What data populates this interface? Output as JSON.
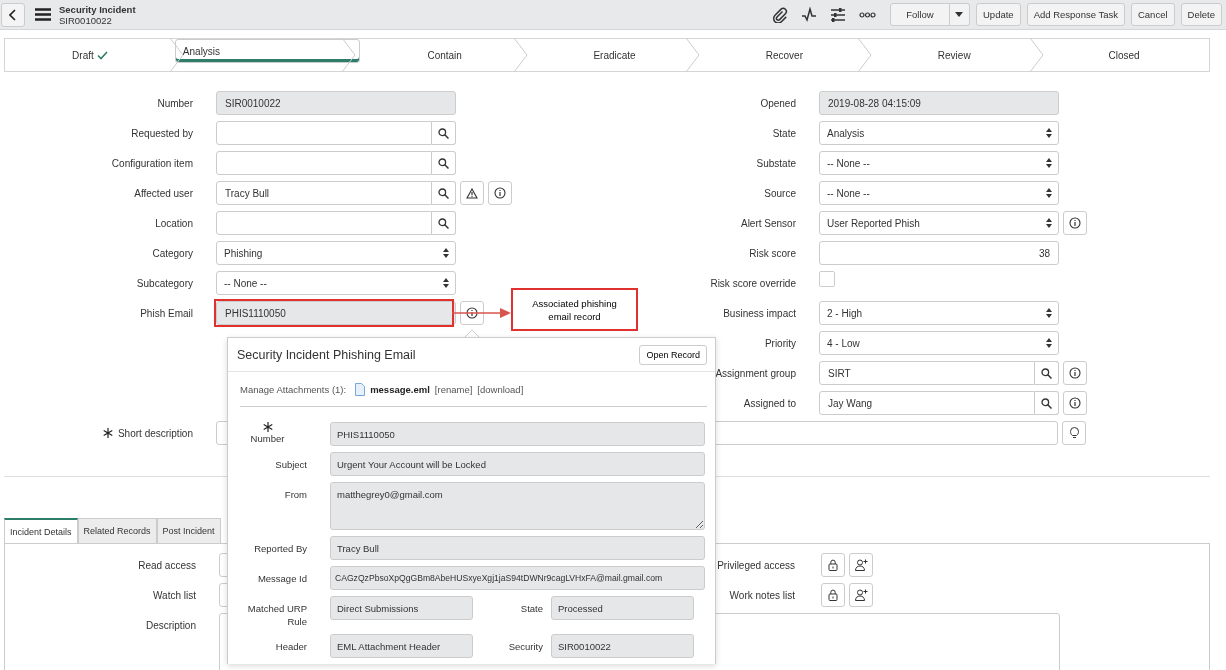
{
  "header": {
    "title": "Security Incident",
    "number": "SIR0010022",
    "buttons": [
      {
        "label": "Follow",
        "kind": "split"
      },
      {
        "label": "Update",
        "kind": "plain"
      },
      {
        "label": "Add Response Task",
        "kind": "plain"
      },
      {
        "label": "Cancel",
        "kind": "plain"
      },
      {
        "label": "Delete",
        "kind": "plain"
      }
    ]
  },
  "stages": [
    {
      "label": "Draft",
      "done": true,
      "selected": false
    },
    {
      "label": "Analysis",
      "done": false,
      "selected": true
    },
    {
      "label": "Contain",
      "done": false,
      "selected": false
    },
    {
      "label": "Eradicate",
      "done": false,
      "selected": false
    },
    {
      "label": "Recover",
      "done": false,
      "selected": false
    },
    {
      "label": "Review",
      "done": false,
      "selected": false
    },
    {
      "label": "Closed",
      "done": false,
      "selected": false
    }
  ],
  "left_fields": [
    {
      "label": "Number",
      "kind": "readonly",
      "value": "SIR0010022"
    },
    {
      "label": "Requested by",
      "kind": "lookup"
    },
    {
      "label": "Configuration item",
      "kind": "lookup"
    },
    {
      "label": "Affected user",
      "kind": "lookup",
      "value": "Tracy Bull",
      "actions": [
        {
          "kind": "alert"
        },
        {
          "kind": "info"
        }
      ]
    },
    {
      "label": "Location",
      "kind": "lookup"
    },
    {
      "label": "Category",
      "kind": "select",
      "value": "Phishing"
    },
    {
      "label": "Subcategory",
      "kind": "select",
      "value": "-- None --"
    },
    {
      "label": "Phish Email",
      "kind": "readonly",
      "value": "PHIS1110050",
      "actions": [
        {
          "kind": "info"
        }
      ],
      "highlighted": true
    }
  ],
  "right_fields": [
    {
      "label": "Opened",
      "kind": "readonly",
      "value": "2019-08-28 04:15:09"
    },
    {
      "label": "State",
      "kind": "select",
      "value": "Analysis"
    },
    {
      "label": "Substate",
      "kind": "select",
      "value": "-- None --"
    },
    {
      "label": "Source",
      "kind": "select",
      "value": "-- None --"
    },
    {
      "label": "Alert Sensor",
      "kind": "select",
      "value": "User Reported Phish",
      "actions": [
        {
          "kind": "info"
        }
      ]
    },
    {
      "label": "Risk score",
      "kind": "number",
      "value": "38"
    },
    {
      "label": "Risk score override",
      "kind": "checkbox",
      "checked": false
    },
    {
      "label": "Business impact",
      "kind": "select",
      "value": "2 - High"
    },
    {
      "label": "Priority",
      "kind": "select",
      "value": "4 - Low"
    },
    {
      "label": "Assignment group",
      "kind": "lookup",
      "value": "SIRT",
      "actions": [
        {
          "kind": "info"
        }
      ]
    },
    {
      "label": "Assigned to",
      "kind": "lookup",
      "value": "Jay Wang",
      "actions": [
        {
          "kind": "info"
        }
      ]
    }
  ],
  "short_description": {
    "label": "Short description",
    "required": true
  },
  "annotation": {
    "text": "Associated phishing email record"
  },
  "tabs": [
    {
      "label": "Incident Details",
      "selected": true
    },
    {
      "label": "Related Records",
      "selected": false
    },
    {
      "label": "Post Incident",
      "selected": false
    }
  ],
  "details": {
    "left": [
      {
        "label": "Read access",
        "kind": "text"
      },
      {
        "label": "Watch list",
        "kind": "text"
      }
    ],
    "right": [
      {
        "label": "Privileged access",
        "kind": "access"
      },
      {
        "label": "Work notes list",
        "kind": "access"
      }
    ],
    "description": {
      "label": "Description"
    }
  },
  "popup": {
    "title": "Security Incident Phishing Email",
    "open_button": "Open Record",
    "attachments_label": "Manage Attachments (1):",
    "file_name": "message.eml",
    "file_actions": [
      "[rename]",
      "[download]"
    ],
    "fields": [
      {
        "kind": "full",
        "label": "Number",
        "value": "PHIS1110050",
        "required": true
      },
      {
        "kind": "full",
        "label": "Subject",
        "value": "Urgent Your Account will be Locked"
      },
      {
        "kind": "textarea",
        "label": "From",
        "value": "matthegrey0@gmail.com"
      },
      {
        "kind": "full",
        "label": "Reported By",
        "value": "Tracy Bull"
      },
      {
        "kind": "full",
        "label": "Message Id",
        "value": "CAGzQzPbsoXpQgGBm8AbeHUSxyeXgj1jaS94tDWNr9cagLVHxFA@mail.gmail.com"
      },
      {
        "kind": "pair",
        "label": "Matched URP Rule",
        "value": "Direct Submissions",
        "label2": "State",
        "value2": "Processed"
      },
      {
        "kind": "pair",
        "label": "Header",
        "value": "EML Attachment Header",
        "label2": "Security",
        "value2": "SIR0010022"
      }
    ]
  }
}
